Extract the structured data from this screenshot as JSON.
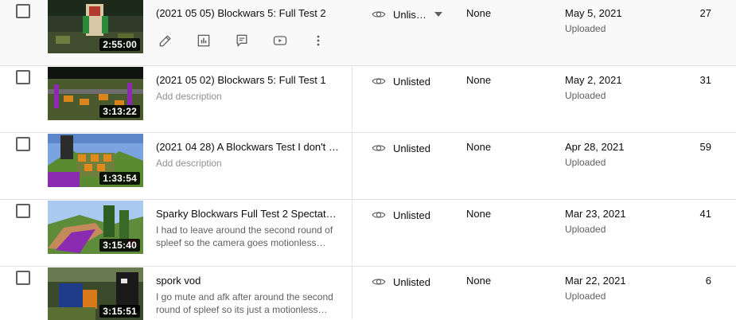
{
  "actions": {
    "details": "pencil-icon",
    "analytics": "analytics-icon",
    "comments": "comments-icon",
    "youtube": "youtube-icon",
    "options": "more-options-icon"
  },
  "videos": [
    {
      "title": "(2021 05 05) Blockwars 5: Full Test 2",
      "description": "",
      "duration": "2:55:00",
      "visibility": "Unlis…",
      "restrictions": "None",
      "date": "May 5, 2021",
      "date_status": "Uploaded",
      "views": "27"
    },
    {
      "title": "(2021 05 02) Blockwars 5: Full Test 1",
      "description": "Add description",
      "duration": "3:13:22",
      "visibility": "Unlisted",
      "restrictions": "None",
      "date": "May 2, 2021",
      "date_status": "Uploaded",
      "views": "31"
    },
    {
      "title": "(2021 04 28) A Blockwars Test I don't …",
      "description": "Add description",
      "duration": "1:33:54",
      "visibility": "Unlisted",
      "restrictions": "None",
      "date": "Apr 28, 2021",
      "date_status": "Uploaded",
      "views": "59"
    },
    {
      "title": "Sparky Blockwars Full Test 2 Spectato…",
      "description": "I had to leave around the second round of spleef so the camera goes motionless…",
      "duration": "3:15:40",
      "visibility": "Unlisted",
      "restrictions": "None",
      "date": "Mar 23, 2021",
      "date_status": "Uploaded",
      "views": "41"
    },
    {
      "title": "spork vod",
      "description": "I go mute and afk after around the second round of spleef so its just a motionless…",
      "duration": "3:15:51",
      "visibility": "Unlisted",
      "restrictions": "None",
      "date": "Mar 22, 2021",
      "date_status": "Uploaded",
      "views": "6"
    }
  ]
}
